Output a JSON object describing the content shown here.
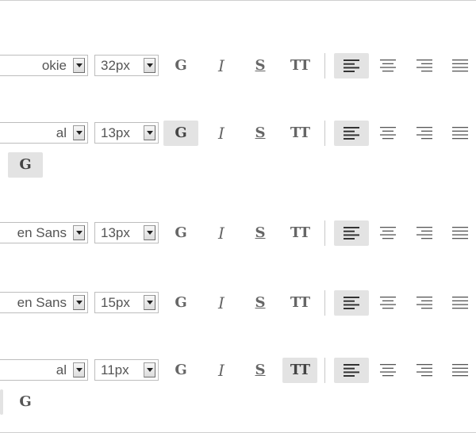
{
  "toolbars": [
    {
      "font": "okie",
      "size": "32px"
    },
    {
      "font": "al",
      "size": "13px"
    },
    {
      "font": "en Sans",
      "size": "13px"
    },
    {
      "font": "en Sans",
      "size": "15px"
    },
    {
      "font": "al",
      "size": "11px"
    }
  ],
  "buttons": {
    "bold": "G",
    "italic": "I",
    "strike": "S",
    "caps": "TT"
  },
  "extra": {
    "row2_label": "G",
    "row5_label": "G"
  },
  "icons": {
    "align_left": "align-left-icon",
    "align_center": "align-center-icon",
    "align_right": "align-right-icon",
    "align_justify": "align-justify-icon",
    "dropdown": "chevron-down-icon"
  },
  "colors": {
    "active_bg": "#e3e3e3",
    "text": "#666666",
    "border": "#bdbdbd"
  }
}
